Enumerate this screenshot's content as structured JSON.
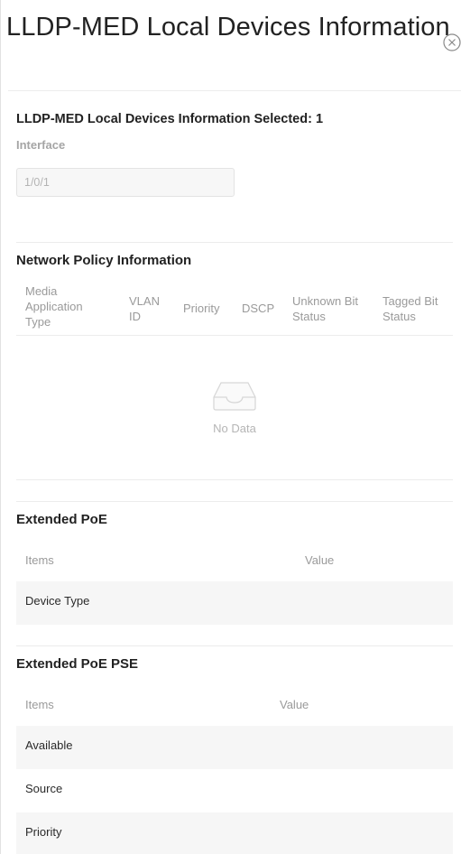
{
  "dialog": {
    "title": "LLDP-MED Local Devices Information",
    "close_icon": "close-circle-icon"
  },
  "selection": {
    "heading": "LLDP-MED Local Devices Information Selected: 1",
    "interface_label": "Interface",
    "interface_value": "1/0/1"
  },
  "network_policy": {
    "title": "Network Policy Information",
    "columns": [
      {
        "key": "media",
        "lines": [
          "Media",
          "Application",
          "Type"
        ]
      },
      {
        "key": "vlan",
        "lines": [
          "VLAN",
          "ID"
        ]
      },
      {
        "key": "priority",
        "lines": [
          "Priority"
        ]
      },
      {
        "key": "dscp",
        "lines": [
          "DSCP"
        ]
      },
      {
        "key": "unknown",
        "lines": [
          "Unknown Bit",
          "Status"
        ]
      },
      {
        "key": "tagged",
        "lines": [
          "Tagged Bit",
          "Status"
        ]
      }
    ],
    "empty_icon": "inbox-icon",
    "empty_text": "No Data"
  },
  "extended_poe": {
    "title": "Extended PoE",
    "header_items": "Items",
    "header_value": "Value",
    "rows": [
      {
        "item": "Device Type",
        "value": ""
      }
    ]
  },
  "extended_poe_pse": {
    "title": "Extended PoE PSE",
    "header_items": "Items",
    "header_value": "Value",
    "rows": [
      {
        "item": "Available",
        "value": ""
      },
      {
        "item": "Source",
        "value": ""
      },
      {
        "item": "Priority",
        "value": ""
      }
    ]
  }
}
